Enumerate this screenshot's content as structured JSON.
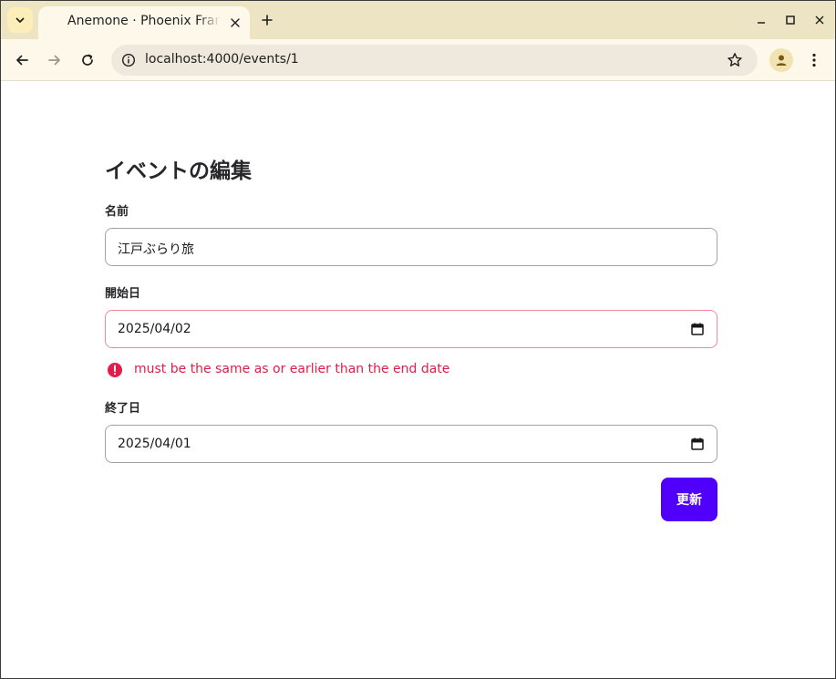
{
  "browser": {
    "tab": {
      "title": "Anemone · Phoenix Framework"
    },
    "address_bar": {
      "url": "localhost:4000/events/1"
    },
    "colors": {
      "tabstrip": "#ede4c3",
      "toolbar": "#fdf8ea",
      "accent": "#5000fa",
      "error": "#e11d48"
    }
  },
  "page": {
    "title": "イベントの編集",
    "form": {
      "name_label": "名前",
      "name_value": "江戸ぶらり旅",
      "start_label": "開始日",
      "start_value": "2025/04/02",
      "start_error": "must be the same as or earlier than the end date",
      "end_label": "終了日",
      "end_value": "2025/04/01",
      "submit_label": "更新"
    }
  },
  "icons": [
    "tab-search-icon",
    "close-icon",
    "plus-icon",
    "minimize-icon",
    "maximize-icon",
    "window-close-icon",
    "back-icon",
    "forward-icon",
    "reload-icon",
    "info-icon",
    "star-icon",
    "profile-icon",
    "menu-icon",
    "calendar-icon",
    "error-icon"
  ]
}
